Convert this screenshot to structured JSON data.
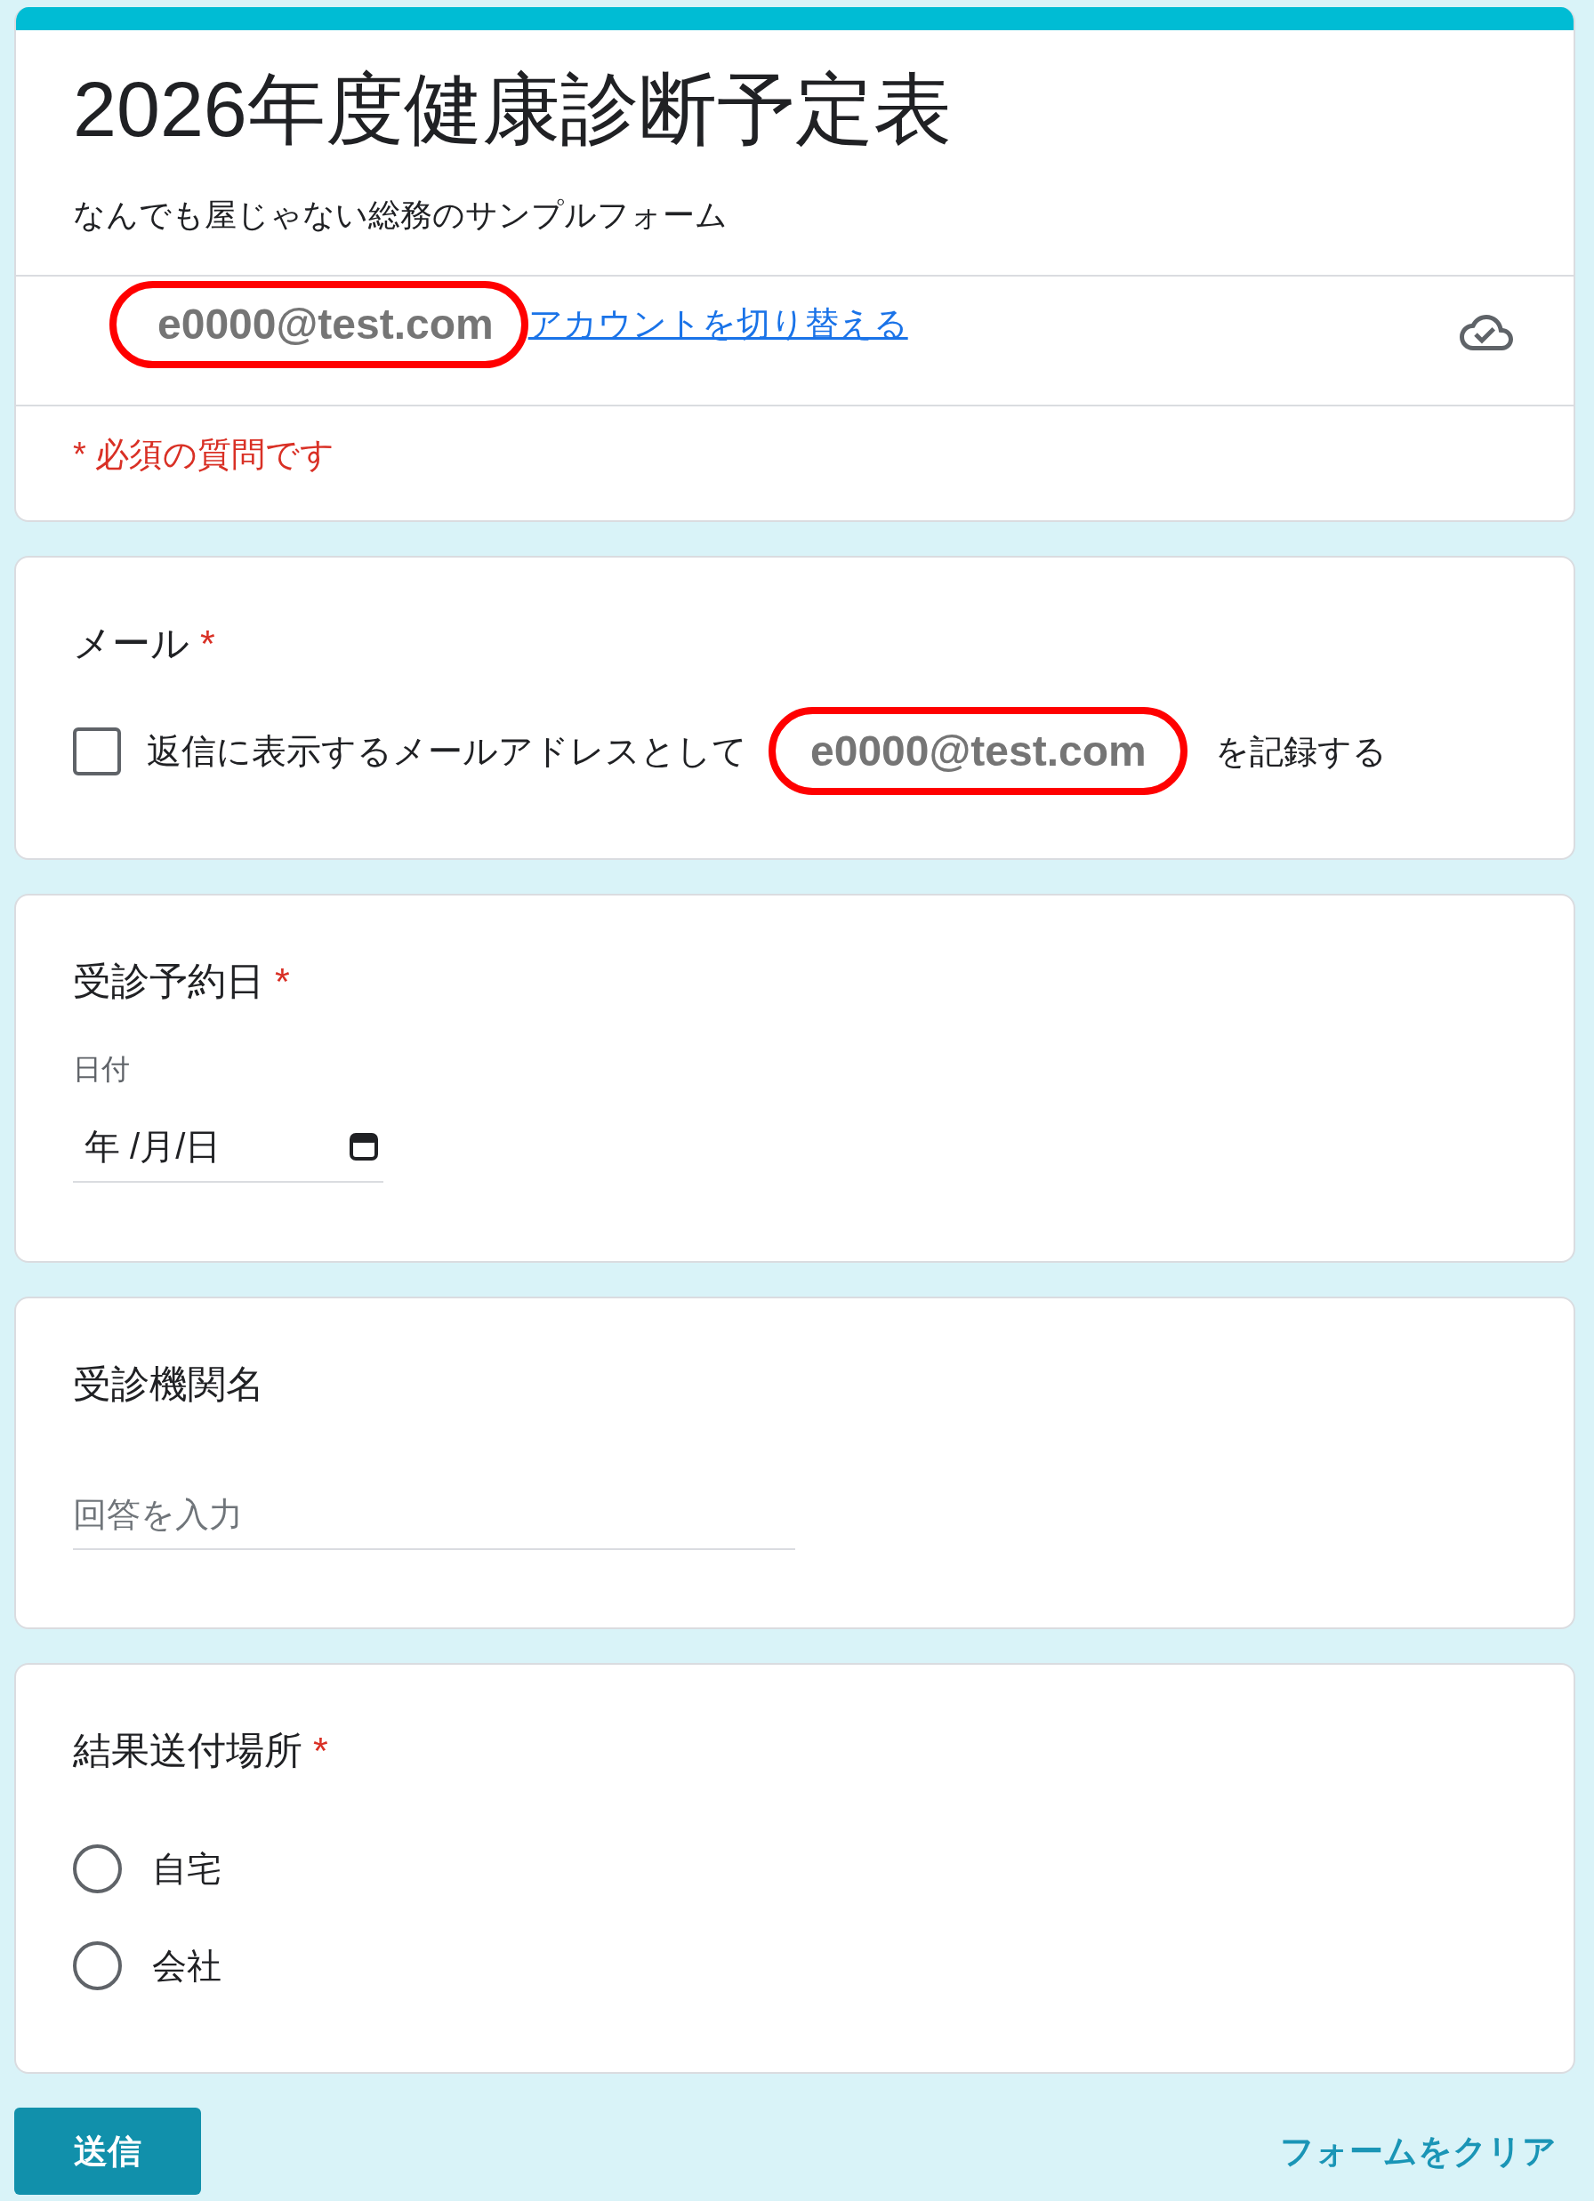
{
  "header": {
    "title": "2026年度健康診断予定表",
    "description": "なんでも屋じゃない総務のサンプルフォーム",
    "account": {
      "email": "e0000@test.com",
      "circled": true,
      "switch_link": "アカウントを切り替える"
    },
    "required_note": "* 必須の質問です"
  },
  "questions": [
    {
      "kind": "email",
      "title": "メール",
      "required_mark": "*",
      "checkbox": {
        "checked": false,
        "label": "返信に表示するメールアドレスとして",
        "email": "e0000@test.com",
        "email_circled": true,
        "label_end": "を記録する"
      }
    },
    {
      "kind": "date",
      "title": "受診予約日",
      "required_mark": "*",
      "field_label": "日付",
      "placeholder": "年 /月/日"
    },
    {
      "kind": "text",
      "title": "受診機関名",
      "placeholder": "回答を入力"
    },
    {
      "kind": "radio",
      "title": "結果送付場所",
      "required_mark": "*",
      "options": [
        {
          "label": "自宅",
          "selected": false
        },
        {
          "label": "会社",
          "selected": false
        }
      ]
    }
  ],
  "footer": {
    "submit": "送信",
    "clear": "フォームをクリア"
  }
}
